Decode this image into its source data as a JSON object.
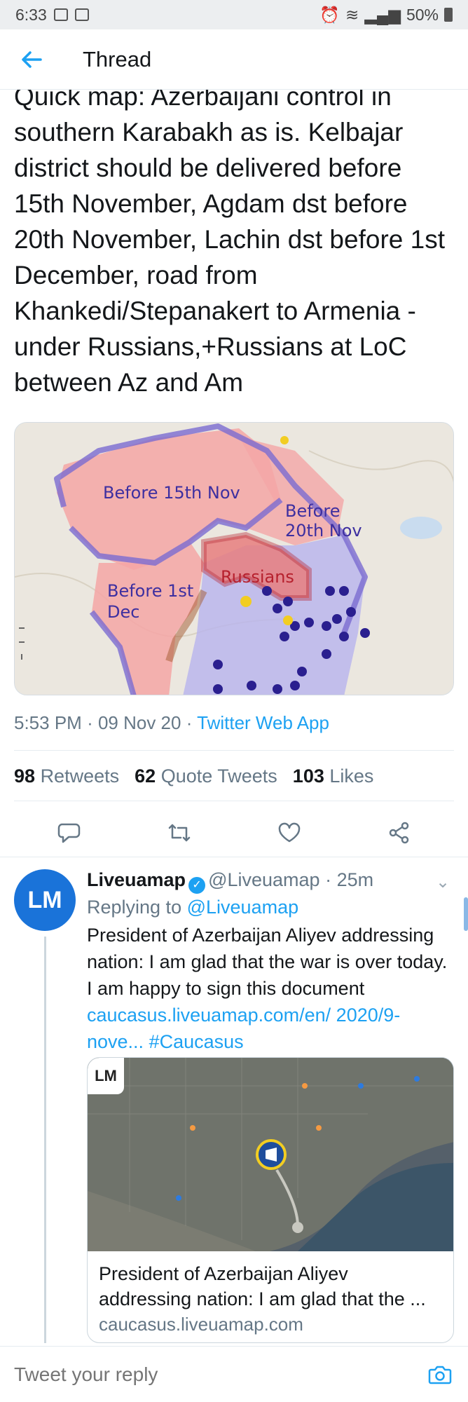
{
  "status_bar": {
    "time": "6:33",
    "battery": "50%"
  },
  "header": {
    "title": "Thread"
  },
  "tweet": {
    "text": "Quick map: Azerbaijani control in southern Karabakh as is. Kelbajar district should be delivered before 15th November, Agdam dst before 20th November, Lachin dst before 1st December, road from Khankedi/Stepanakert to Armenia - under Russians,+Russians at LoC between Az and Am",
    "map_labels": {
      "kelbajar": "Before 15th Nov",
      "agdam_line1": "Before",
      "agdam_line2": "20th Nov",
      "lachin_line1": "Before 1st",
      "lachin_line2": "Dec",
      "russians": "Russians"
    },
    "time": "5:53 PM",
    "date": "09 Nov 20",
    "app": "Twitter Web App",
    "retweets_count": "98",
    "retweets_label": "Retweets",
    "quotes_count": "62",
    "quotes_label": "Quote Tweets",
    "likes_count": "103",
    "likes_label": "Likes"
  },
  "reply": {
    "avatar_text": "LM",
    "name": "Liveuamap",
    "handle": "@Liveuamap",
    "age": "25m",
    "replying_prefix": "Replying to",
    "replying_to": "@Liveuamap",
    "text": "President of Azerbaijan Aliyev addressing nation: I am glad that the war is over today. I am happy to sign this document",
    "link": "caucasus.liveuamap.com/en/ 2020/9-nove...",
    "hashtag": "#Caucasus",
    "card": {
      "logo_text": "LM",
      "title": "President of Azerbaijan Aliyev addressing nation: I am glad that the ...",
      "domain": "caucasus.liveuamap.com"
    }
  },
  "compose": {
    "placeholder": "Tweet your reply"
  },
  "colors": {
    "accent": "#1da1f2",
    "azerbaijan_area": "#f4a6a6",
    "russians_area": "#b8b4ee",
    "border_line": "#7a6bd1"
  }
}
